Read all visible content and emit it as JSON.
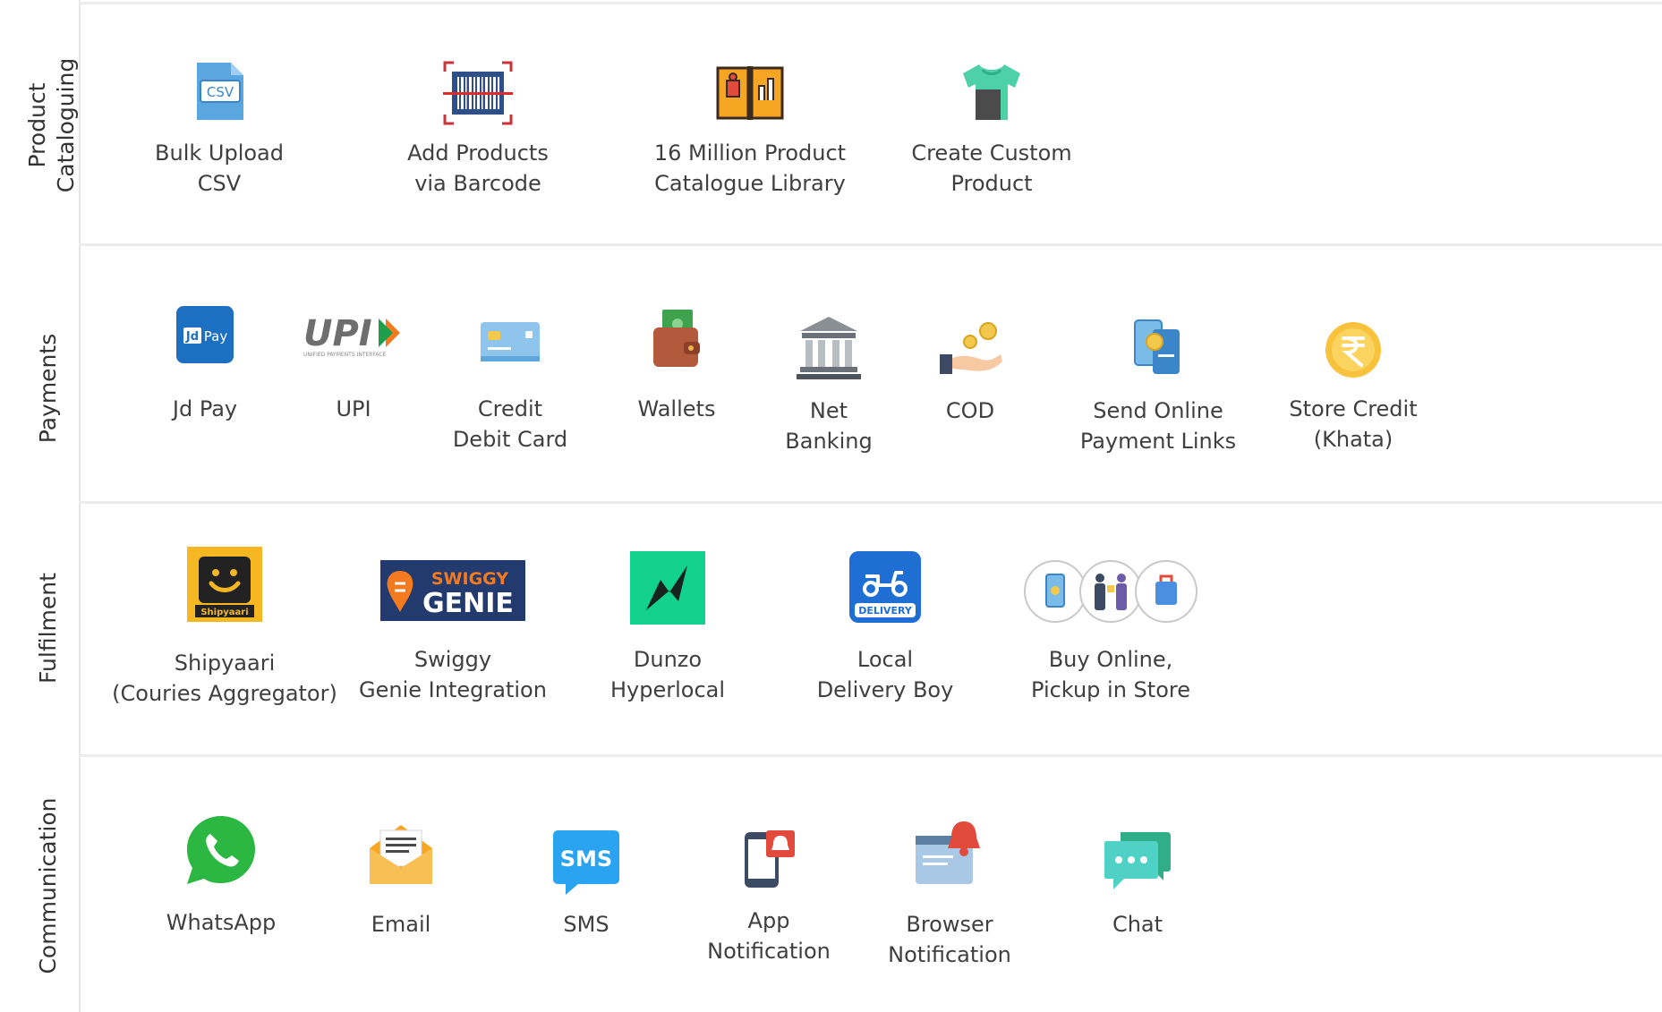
{
  "sections": {
    "catalog": {
      "title_line1": "Product",
      "title_line2": "Cataloguing",
      "items": [
        {
          "l1": "Bulk Upload",
          "l2": "CSV",
          "icon": "csv-file-icon"
        },
        {
          "l1": "Add Products",
          "l2": "via Barcode",
          "icon": "barcode-icon"
        },
        {
          "l1": "16 Million Product",
          "l2": "Catalogue Library",
          "icon": "catalogue-book-icon"
        },
        {
          "l1": "Create Custom",
          "l2": "Product",
          "icon": "tshirt-icon"
        }
      ]
    },
    "payments": {
      "title": "Payments",
      "jdpay_logo_jd": "Jd",
      "jdpay_logo_pay": "Pay",
      "upi_logo": "UPI",
      "upi_tagline": "UNIFIED PAYMENTS INTERFACE",
      "items": [
        {
          "l1": "Jd Pay",
          "l2": "",
          "icon": "jd-pay-logo-icon"
        },
        {
          "l1": "UPI",
          "l2": "",
          "icon": "upi-logo-icon"
        },
        {
          "l1": "Credit",
          "l2": "Debit Card",
          "icon": "credit-card-icon"
        },
        {
          "l1": "Wallets",
          "l2": "",
          "icon": "wallet-icon"
        },
        {
          "l1": "Net",
          "l2": "Banking",
          "icon": "bank-icon"
        },
        {
          "l1": "COD",
          "l2": "",
          "icon": "cash-hand-icon"
        },
        {
          "l1": "Send Online",
          "l2": "Payment Links",
          "icon": "payment-link-phone-icon"
        },
        {
          "l1": "Store Credit",
          "l2": "(Khata)",
          "icon": "rupee-coin-icon"
        }
      ]
    },
    "fulfilment": {
      "title": "Fulfilment",
      "shipyaari_logo": "Shipyaari",
      "swiggy_logo_l1": "SWIGGY",
      "swiggy_logo_l2": "GENIE",
      "delivery_badge": "DELIVERY",
      "items": [
        {
          "l1": "Shipyaari",
          "l2": "(Couries Aggregator)",
          "icon": "shipyaari-logo-icon"
        },
        {
          "l1": "Swiggy",
          "l2": "Genie Integration",
          "icon": "swiggy-genie-logo-icon"
        },
        {
          "l1": "Dunzo",
          "l2": "Hyperlocal",
          "icon": "dunzo-logo-icon"
        },
        {
          "l1": "Local",
          "l2": "Delivery Boy",
          "icon": "delivery-scooter-icon"
        },
        {
          "l1": "Buy Online,",
          "l2": "Pickup in Store",
          "icon": "store-pickup-icon"
        }
      ]
    },
    "communication": {
      "title": "Communication",
      "sms_badge": "SMS",
      "items": [
        {
          "l1": "WhatsApp",
          "l2": "",
          "icon": "whatsapp-icon"
        },
        {
          "l1": "Email",
          "l2": "",
          "icon": "email-icon"
        },
        {
          "l1": "SMS",
          "l2": "",
          "icon": "sms-bubble-icon"
        },
        {
          "l1": "App",
          "l2": "Notification",
          "icon": "app-notification-icon"
        },
        {
          "l1": "Browser",
          "l2": "Notification",
          "icon": "browser-bell-icon"
        },
        {
          "l1": "Chat",
          "l2": "",
          "icon": "chat-bubble-icon"
        }
      ]
    }
  }
}
